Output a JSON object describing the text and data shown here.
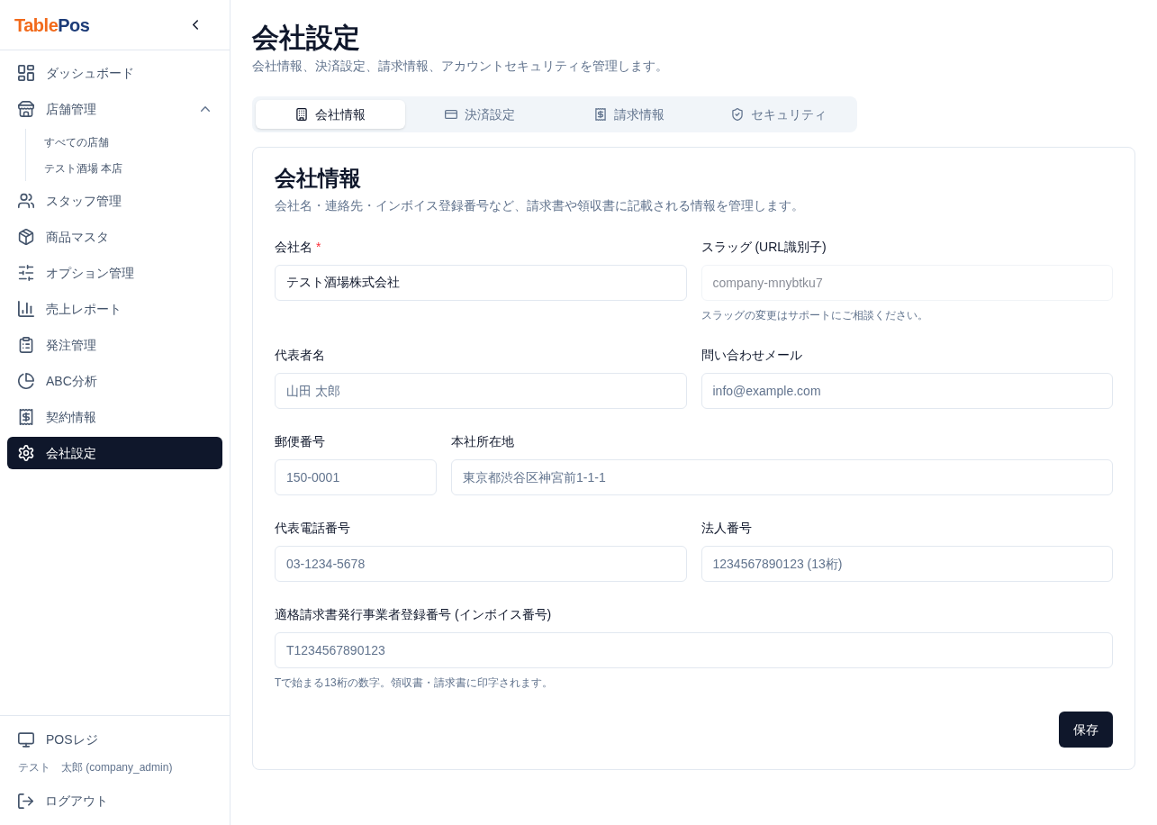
{
  "sidebar": {
    "logo": {
      "first": "Table",
      "second": "Pos"
    },
    "items": [
      {
        "label": "ダッシュボード",
        "selected": false
      },
      {
        "label": "店舗管理",
        "selected": false,
        "expanded": true,
        "children": [
          {
            "label": "すべての店舗",
            "selected": false
          },
          {
            "label": "テスト酒場 本店",
            "selected": false
          }
        ]
      },
      {
        "label": "スタッフ管理",
        "selected": false
      },
      {
        "label": "商品マスタ",
        "selected": false
      },
      {
        "label": "オプション管理",
        "selected": false
      },
      {
        "label": "売上レポート",
        "selected": false
      },
      {
        "label": "発注管理",
        "selected": false
      },
      {
        "label": "ABC分析",
        "selected": false
      },
      {
        "label": "契約情報",
        "selected": false
      },
      {
        "label": "会社設定",
        "selected": true
      }
    ],
    "footer": {
      "pos_link": "POSレジ",
      "user": "テスト　太郎 (company_admin)",
      "logout": "ログアウト"
    }
  },
  "header": {
    "title": "会社設定",
    "subtitle": "会社情報、決済設定、請求情報、アカウントセキュリティを管理します。"
  },
  "tabs": [
    {
      "label": "会社情報",
      "selected": true
    },
    {
      "label": "決済設定",
      "selected": false
    },
    {
      "label": "請求情報",
      "selected": false
    },
    {
      "label": "セキュリティ",
      "selected": false
    }
  ],
  "card": {
    "title": "会社情報",
    "description": "会社名・連絡先・インボイス登録番号など、請求書や領収書に記載される情報を管理します。",
    "rows": [
      {
        "kind": "pair",
        "fields": [
          {
            "label": "会社名",
            "required_mark": "*",
            "value": "テスト酒場株式会社",
            "disabled": false
          },
          {
            "label": "スラッグ (URL識別子)",
            "value": "company-mnybtku7",
            "disabled": true,
            "hint": "スラッグの変更はサポートにご相談ください。"
          }
        ]
      },
      {
        "kind": "pair",
        "fields": [
          {
            "label": "代表者名",
            "placeholder": "山田 太郎",
            "disabled": false
          },
          {
            "label": "問い合わせメール",
            "placeholder": "info@example.com",
            "disabled": false
          }
        ]
      },
      {
        "kind": "address",
        "fields": [
          {
            "label": "郵便番号",
            "placeholder": "150-0001",
            "disabled": false
          },
          {
            "label": "本社所在地",
            "placeholder": "東京都渋谷区神宮前1-1-1",
            "disabled": false
          }
        ]
      },
      {
        "kind": "pair",
        "fields": [
          {
            "label": "代表電話番号",
            "placeholder": "03-1234-5678",
            "disabled": false
          },
          {
            "label": "法人番号",
            "placeholder": "1234567890123 (13桁)",
            "disabled": false
          }
        ]
      },
      {
        "kind": "single",
        "fields": [
          {
            "label": "適格請求書発行事業者登録番号 (インボイス番号)",
            "placeholder": "T1234567890123",
            "disabled": false,
            "hint": "Tで始まる13桁の数字。領収書・請求書に印字されます。"
          }
        ]
      }
    ],
    "save_button": "保存"
  }
}
